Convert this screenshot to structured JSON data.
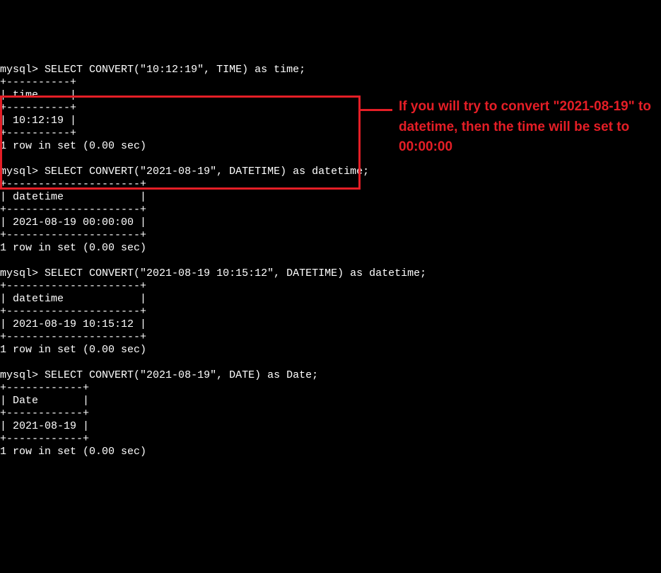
{
  "prompt": "mysql>",
  "queries": {
    "q1": {
      "sql": "SELECT CONVERT(\"10:12:19\", TIME) as time;",
      "sep": "+----------+",
      "header": "| time     |",
      "row": "| 10:12:19 |",
      "footer": "1 row in set (0.00 sec)"
    },
    "q2": {
      "sql": "SELECT CONVERT(\"2021-08-19\", DATETIME) as datetime;",
      "sep": "+---------------------+",
      "header": "| datetime            |",
      "row": "| 2021-08-19 00:00:00 |",
      "footer": "1 row in set (0.00 sec)"
    },
    "q3": {
      "sql": "SELECT CONVERT(\"2021-08-19 10:15:12\", DATETIME) as datetime;",
      "sep": "+---------------------+",
      "header": "| datetime            |",
      "row": "| 2021-08-19 10:15:12 |",
      "footer": "1 row in set (0.00 sec)"
    },
    "q4": {
      "sql": "SELECT CONVERT(\"2021-08-19\", DATE) as Date;",
      "sep": "+------------+",
      "header": "| Date       |",
      "row": "| 2021-08-19 |",
      "footer": "1 row in set (0.00 sec)"
    }
  },
  "annotation": "If you will try to convert \"2021-08-19\" to datetime, then the time will be set to 00:00:00"
}
